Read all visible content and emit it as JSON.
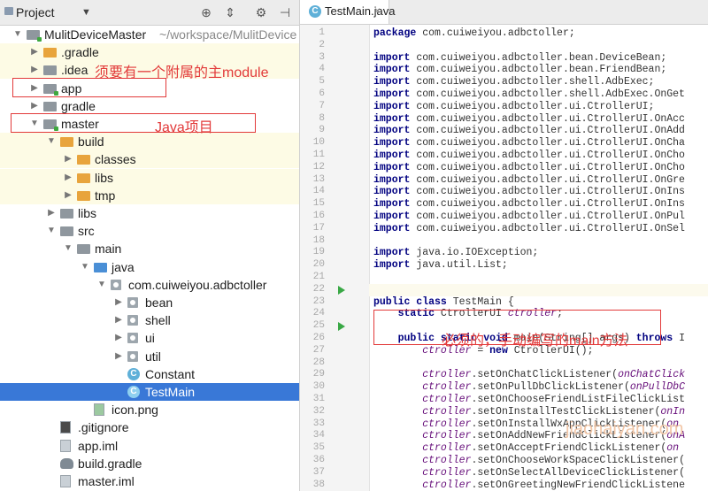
{
  "project_panel": {
    "title": "Project",
    "tree": [
      {
        "label": "MulitDeviceMaster",
        "path": "~/workspace/MulitDevice",
        "icon": "module-folder-icon",
        "indent": 0,
        "arrow": "down",
        "hl": false
      },
      {
        "label": ".gradle",
        "icon": "folder-orange-icon",
        "indent": 1,
        "arrow": "right",
        "hl": true
      },
      {
        "label": ".idea",
        "icon": "folder-gray-icon",
        "indent": 1,
        "arrow": "right",
        "hl": true
      },
      {
        "label": "app",
        "icon": "module-folder-icon",
        "indent": 1,
        "arrow": "right",
        "hl": false
      },
      {
        "label": "gradle",
        "icon": "folder-gray-icon",
        "indent": 1,
        "arrow": "right",
        "hl": false
      },
      {
        "label": "master",
        "icon": "module-folder-icon",
        "indent": 1,
        "arrow": "down",
        "hl": false
      },
      {
        "label": "build",
        "icon": "folder-orange-icon",
        "indent": 2,
        "arrow": "down",
        "hl": true
      },
      {
        "label": "classes",
        "icon": "folder-orange-icon",
        "indent": 3,
        "arrow": "right",
        "hl": true
      },
      {
        "label": "libs",
        "icon": "folder-orange-icon",
        "indent": 3,
        "arrow": "right",
        "hl": true
      },
      {
        "label": "tmp",
        "icon": "folder-orange-icon",
        "indent": 3,
        "arrow": "right",
        "hl": true
      },
      {
        "label": "libs",
        "icon": "folder-gray-icon",
        "indent": 2,
        "arrow": "right",
        "hl": false
      },
      {
        "label": "src",
        "icon": "folder-gray-icon",
        "indent": 2,
        "arrow": "down",
        "hl": false
      },
      {
        "label": "main",
        "icon": "folder-gray-icon",
        "indent": 3,
        "arrow": "down",
        "hl": false
      },
      {
        "label": "java",
        "icon": "folder-blue-icon",
        "indent": 4,
        "arrow": "down",
        "hl": false
      },
      {
        "label": "com.cuiweiyou.adbctoller",
        "icon": "package-icon",
        "indent": 5,
        "arrow": "down",
        "hl": false
      },
      {
        "label": "bean",
        "icon": "package-icon",
        "indent": 6,
        "arrow": "right",
        "hl": false
      },
      {
        "label": "shell",
        "icon": "package-icon",
        "indent": 6,
        "arrow": "right",
        "hl": false
      },
      {
        "label": "ui",
        "icon": "package-icon",
        "indent": 6,
        "arrow": "right",
        "hl": false
      },
      {
        "label": "util",
        "icon": "package-icon",
        "indent": 6,
        "arrow": "right",
        "hl": false
      },
      {
        "label": "Constant",
        "icon": "class-icon",
        "indent": 6,
        "arrow": "none",
        "hl": false
      },
      {
        "label": "TestMain",
        "icon": "class-icon",
        "indent": 6,
        "arrow": "none",
        "hl": false,
        "selected": true
      },
      {
        "label": "icon.png",
        "icon": "image-file-icon",
        "indent": 4,
        "arrow": "none",
        "hl": false
      },
      {
        "label": ".gitignore",
        "icon": "git-file-icon",
        "indent": 2,
        "arrow": "none",
        "hl": false
      },
      {
        "label": "app.iml",
        "icon": "iml-file-icon",
        "indent": 2,
        "arrow": "none",
        "hl": false
      },
      {
        "label": "build.gradle",
        "icon": "gradle-icon",
        "indent": 2,
        "arrow": "none",
        "hl": false
      },
      {
        "label": "master.iml",
        "icon": "iml-file-icon",
        "indent": 2,
        "arrow": "none",
        "hl": false
      }
    ]
  },
  "annotations": {
    "app_note": "须要有一个附属的主module",
    "master_note": "Java项目",
    "main_note": "必须的，手动编写的main方法"
  },
  "watermark": "jiaohaiyan.com",
  "editor": {
    "tab_label": "TestMain.java",
    "line_start": 1,
    "lines": [
      [
        [
          "kw",
          "package "
        ],
        [
          "pk",
          "com.cuiweiyou.adbctoller;"
        ]
      ],
      [],
      [
        [
          "kw",
          "import "
        ],
        [
          "pk",
          "com.cuiweiyou.adbctoller.bean.DeviceBean;"
        ]
      ],
      [
        [
          "kw",
          "import "
        ],
        [
          "pk",
          "com.cuiweiyou.adbctoller.bean.FriendBean;"
        ]
      ],
      [
        [
          "kw",
          "import "
        ],
        [
          "pk",
          "com.cuiweiyou.adbctoller.shell.AdbExec;"
        ]
      ],
      [
        [
          "kw",
          "import "
        ],
        [
          "pk",
          "com.cuiweiyou.adbctoller.shell.AdbExec.OnGet"
        ]
      ],
      [
        [
          "kw",
          "import "
        ],
        [
          "pk",
          "com.cuiweiyou.adbctoller.ui.CtrollerUI;"
        ]
      ],
      [
        [
          "kw",
          "import "
        ],
        [
          "pk",
          "com.cuiweiyou.adbctoller.ui.CtrollerUI.OnAcc"
        ]
      ],
      [
        [
          "kw",
          "import "
        ],
        [
          "pk",
          "com.cuiweiyou.adbctoller.ui.CtrollerUI.OnAdd"
        ]
      ],
      [
        [
          "kw",
          "import "
        ],
        [
          "pk",
          "com.cuiweiyou.adbctoller.ui.CtrollerUI.OnCha"
        ]
      ],
      [
        [
          "kw",
          "import "
        ],
        [
          "pk",
          "com.cuiweiyou.adbctoller.ui.CtrollerUI.OnCho"
        ]
      ],
      [
        [
          "kw",
          "import "
        ],
        [
          "pk",
          "com.cuiweiyou.adbctoller.ui.CtrollerUI.OnCho"
        ]
      ],
      [
        [
          "kw",
          "import "
        ],
        [
          "pk",
          "com.cuiweiyou.adbctoller.ui.CtrollerUI.OnGre"
        ]
      ],
      [
        [
          "kw",
          "import "
        ],
        [
          "pk",
          "com.cuiweiyou.adbctoller.ui.CtrollerUI.OnIns"
        ]
      ],
      [
        [
          "kw",
          "import "
        ],
        [
          "pk",
          "com.cuiweiyou.adbctoller.ui.CtrollerUI.OnIns"
        ]
      ],
      [
        [
          "kw",
          "import "
        ],
        [
          "pk",
          "com.cuiweiyou.adbctoller.ui.CtrollerUI.OnPul"
        ]
      ],
      [
        [
          "kw",
          "import "
        ],
        [
          "pk",
          "com.cuiweiyou.adbctoller.ui.CtrollerUI.OnSel"
        ]
      ],
      [],
      [
        [
          "kw",
          "import "
        ],
        [
          "pk",
          "java.io.IOException;"
        ]
      ],
      [
        [
          "kw",
          "import "
        ],
        [
          "pk",
          "java.util.List;"
        ]
      ],
      [],
      [],
      [
        [
          "kw",
          "public class "
        ],
        [
          "pk",
          "TestMain {"
        ]
      ],
      [
        [
          "pk",
          "    "
        ],
        [
          "kw",
          "static "
        ],
        [
          "pk",
          "CtrollerUI "
        ],
        [
          "fld",
          "ctroller"
        ],
        [
          "pk",
          ";"
        ]
      ],
      [],
      [
        [
          "pk",
          "    "
        ],
        [
          "kw",
          "public static void "
        ],
        [
          "pk",
          "main(String[] args) "
        ],
        [
          "kw",
          "throws "
        ],
        [
          "pk",
          "I"
        ]
      ],
      [
        [
          "pk",
          "        "
        ],
        [
          "fld",
          "ctroller"
        ],
        [
          "pk",
          " = "
        ],
        [
          "kw",
          "new "
        ],
        [
          "pk",
          "CtrollerUI();"
        ]
      ],
      [],
      [
        [
          "pk",
          "        "
        ],
        [
          "fld",
          "ctroller"
        ],
        [
          "pk",
          ".setOnChatClickListener("
        ],
        [
          "it",
          "onChatClick"
        ]
      ],
      [
        [
          "pk",
          "        "
        ],
        [
          "fld",
          "ctroller"
        ],
        [
          "pk",
          ".setOnPullDbClickListener("
        ],
        [
          "it",
          "onPullDbC"
        ]
      ],
      [
        [
          "pk",
          "        "
        ],
        [
          "fld",
          "ctroller"
        ],
        [
          "pk",
          ".setOnChooseFriendListFileClickList"
        ]
      ],
      [
        [
          "pk",
          "        "
        ],
        [
          "fld",
          "ctroller"
        ],
        [
          "pk",
          ".setOnInstallTestClickListener("
        ],
        [
          "it",
          "onIn"
        ]
      ],
      [
        [
          "pk",
          "        "
        ],
        [
          "fld",
          "ctroller"
        ],
        [
          "pk",
          ".setOnInstallWxAppClickListener("
        ],
        [
          "it",
          "on"
        ]
      ],
      [
        [
          "pk",
          "        "
        ],
        [
          "fld",
          "ctroller"
        ],
        [
          "pk",
          ".setOnAddNewFriendClickListener("
        ],
        [
          "it",
          "onA"
        ]
      ],
      [
        [
          "pk",
          "        "
        ],
        [
          "fld",
          "ctroller"
        ],
        [
          "pk",
          ".setOnAcceptFriendClickListener("
        ],
        [
          "it",
          "on"
        ]
      ],
      [
        [
          "pk",
          "        "
        ],
        [
          "fld",
          "ctroller"
        ],
        [
          "pk",
          ".setOnChooseWorkSpaceClickListener("
        ]
      ],
      [
        [
          "pk",
          "        "
        ],
        [
          "fld",
          "ctroller"
        ],
        [
          "pk",
          ".setOnSelectAllDeviceClickListener("
        ]
      ],
      [
        [
          "pk",
          "        "
        ],
        [
          "fld",
          "ctroller"
        ],
        [
          "pk",
          ".setOnGreetingNewFriendClickListene"
        ]
      ]
    ],
    "highlight_line": 22,
    "run_lines": [
      22,
      25
    ]
  }
}
